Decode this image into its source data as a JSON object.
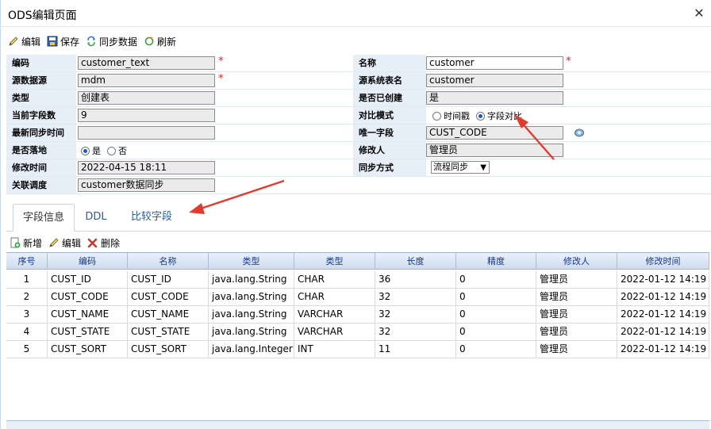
{
  "window": {
    "title": "ODS编辑页面",
    "close_glyph": "✕"
  },
  "toolbar": [
    {
      "label": "编辑",
      "icon": "pencil-icon"
    },
    {
      "label": "保存",
      "icon": "save-icon"
    },
    {
      "label": "同步数据",
      "icon": "sync-icon"
    },
    {
      "label": "刷新",
      "icon": "refresh-icon"
    }
  ],
  "form": {
    "left": [
      {
        "label": "编码",
        "value": "customer_text",
        "required": true,
        "style": "grey"
      },
      {
        "label": "源数据源",
        "value": "mdm",
        "required": true,
        "style": "grey"
      },
      {
        "label": "类型",
        "value": "创建表",
        "style": "grey"
      },
      {
        "label": "当前字段数",
        "value": "9",
        "style": "grey"
      },
      {
        "label": "最新同步时间",
        "value": "",
        "style": "grey"
      },
      {
        "label": "是否落地",
        "radio": [
          "是",
          "否"
        ],
        "selected": "是"
      },
      {
        "label": "修改时间",
        "value": "2022-04-15 18:11",
        "style": "grey"
      },
      {
        "label": "关联调度",
        "value": "customer数据同步",
        "style": "grey"
      }
    ],
    "right": [
      {
        "label": "名称",
        "value": "customer",
        "required": true,
        "style": "white"
      },
      {
        "label": "源系统表名",
        "value": "customer",
        "style": "grey"
      },
      {
        "label": "是否已创建",
        "value": "是",
        "style": "grey"
      },
      {
        "label": "对比模式",
        "radio": [
          "时间戳",
          "字段对比"
        ],
        "selected": "字段对比"
      },
      {
        "label": "唯一字段",
        "value": "CUST_CODE",
        "style": "grey"
      },
      {
        "label": "修改人",
        "value": "管理员",
        "style": "grey"
      },
      {
        "label": "同步方式",
        "select": "流程同步"
      }
    ],
    "required_mark": "*"
  },
  "tabs": [
    {
      "label": "字段信息",
      "active": true
    },
    {
      "label": "DDL",
      "active": false
    },
    {
      "label": "比较字段",
      "active": false
    }
  ],
  "grid_toolbar": [
    {
      "label": "新增",
      "icon": "add-icon"
    },
    {
      "label": "编辑",
      "icon": "pencil-icon"
    },
    {
      "label": "删除",
      "icon": "delete-icon"
    }
  ],
  "grid": {
    "columns": [
      "序号",
      "编码",
      "名称",
      "类型",
      "类型",
      "长度",
      "精度",
      "修改人",
      "修改时间"
    ],
    "rows": [
      [
        "1",
        "CUST_ID",
        "CUST_ID",
        "java.lang.String",
        "CHAR",
        "36",
        "0",
        "管理员",
        "2022-01-12 14:19"
      ],
      [
        "2",
        "CUST_CODE",
        "CUST_CODE",
        "java.lang.String",
        "CHAR",
        "32",
        "0",
        "管理员",
        "2022-01-12 14:19"
      ],
      [
        "3",
        "CUST_NAME",
        "CUST_NAME",
        "java.lang.String",
        "VARCHAR",
        "32",
        "0",
        "管理员",
        "2022-01-12 14:19"
      ],
      [
        "4",
        "CUST_STATE",
        "CUST_STATE",
        "java.lang.String",
        "VARCHAR",
        "32",
        "0",
        "管理员",
        "2022-01-12 14:19"
      ],
      [
        "5",
        "CUST_SORT",
        "CUST_SORT",
        "java.lang.Integer",
        "INT",
        "11",
        "0",
        "管理员",
        "2022-01-12 14:19"
      ]
    ]
  },
  "annotation_color": "#e23b2e"
}
